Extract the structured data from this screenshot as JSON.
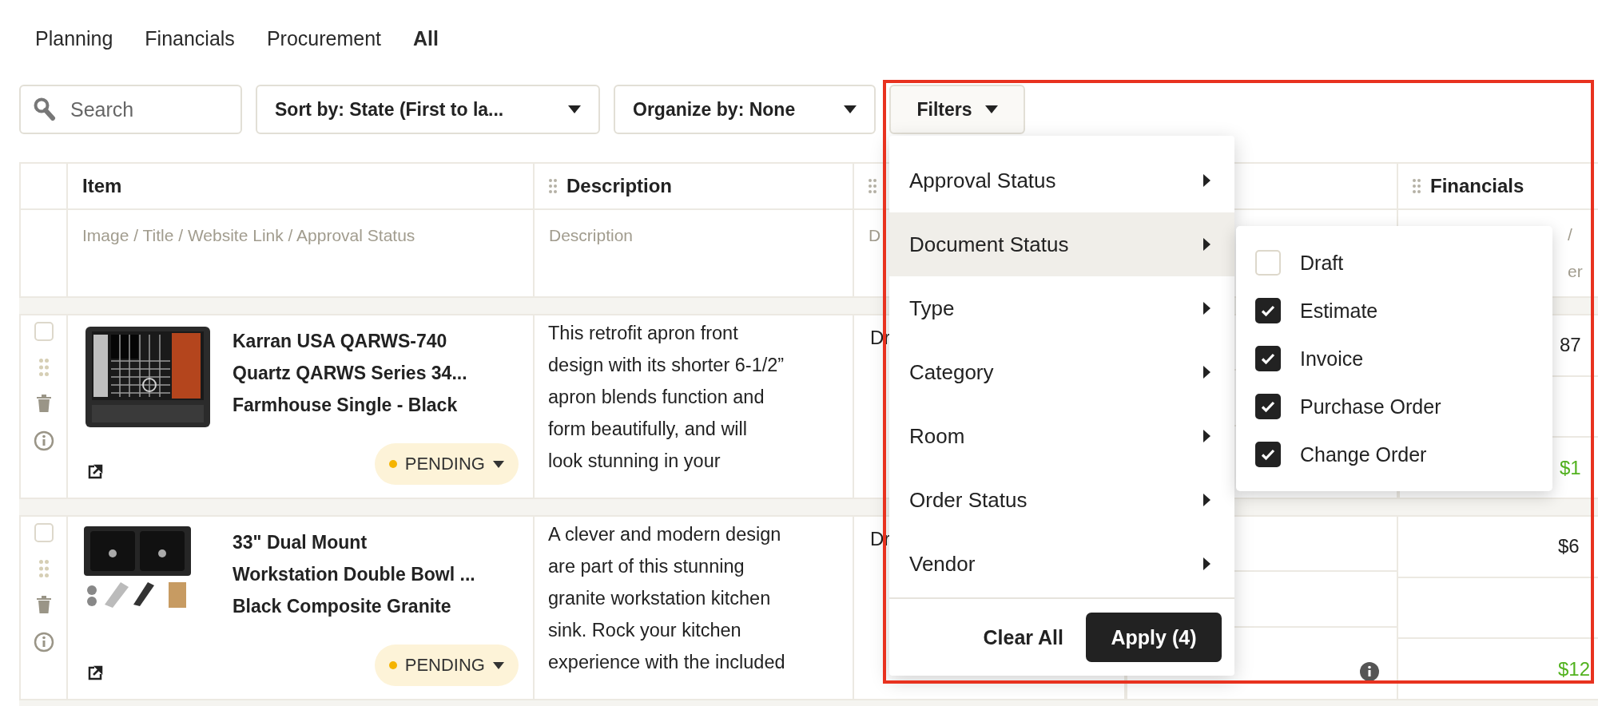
{
  "tabs": [
    {
      "label": "Planning",
      "selected": false
    },
    {
      "label": "Financials",
      "selected": false
    },
    {
      "label": "Procurement",
      "selected": false
    },
    {
      "label": "All",
      "selected": true
    }
  ],
  "toolbar": {
    "search": {
      "placeholder": "Search"
    },
    "sort": "Sort by: State (First to la...",
    "organize": "Organize by: None",
    "filters": "Filters"
  },
  "table": {
    "columns": [
      {
        "label": "Item",
        "handle": false
      },
      {
        "label": "Description",
        "handle": true
      },
      {
        "handle": true
      },
      {
        "label": "Financials",
        "handle": true
      }
    ],
    "subheaders": [
      "Image / Title / Website Link / Approval Status",
      "Description",
      "D",
      "/\ner"
    ],
    "rows": [
      {
        "checked": false,
        "title": "Karran USA QARWS-740\nQuartz QARWS Series 34...\nFarmhouse Single - Black",
        "status": {
          "label": "PENDING",
          "color": "#f5b400"
        },
        "description": "This retrofit apron front\ndesign with its shorter 6-1/2”\napron blends function and\nform beautifully, and will\nlook stunning in your",
        "column_3": "Dr",
        "info_icon": false,
        "financials": [
          {
            "text": "87",
            "color": "#222222"
          },
          {
            "text": "$1",
            "color": "#52b21f"
          }
        ]
      },
      {
        "checked": false,
        "title": "33\" Dual Mount\nWorkstation Double Bowl ...\nBlack Composite Granite",
        "status": {
          "label": "PENDING",
          "color": "#f5b400"
        },
        "description": "A clever and modern design\nare part of this stunning\ngranite workstation kitchen\nsink. Rock your kitchen\nexperience with the included",
        "column_3": "Dr",
        "info_icon": true,
        "financials": [
          {
            "text": "$6",
            "color": "#222222"
          },
          {
            "text": "$12",
            "color": "#52b21f"
          }
        ]
      }
    ]
  },
  "filter_menu": {
    "items": [
      {
        "label": "Approval Status",
        "selected": false
      },
      {
        "label": "Document Status",
        "selected": true
      },
      {
        "label": "Type",
        "selected": false
      },
      {
        "label": "Category",
        "selected": false
      },
      {
        "label": "Room",
        "selected": false
      },
      {
        "label": "Order Status",
        "selected": false
      },
      {
        "label": "Vendor",
        "selected": false
      }
    ],
    "clear": "Clear All",
    "apply": "Apply (4)"
  },
  "submenu": {
    "options": [
      {
        "label": "Draft",
        "checked": false
      },
      {
        "label": "Estimate",
        "checked": true
      },
      {
        "label": "Invoice",
        "checked": true
      },
      {
        "label": "Purchase Order",
        "checked": true
      },
      {
        "label": "Change Order",
        "checked": true
      }
    ]
  },
  "highlight_frame": true
}
